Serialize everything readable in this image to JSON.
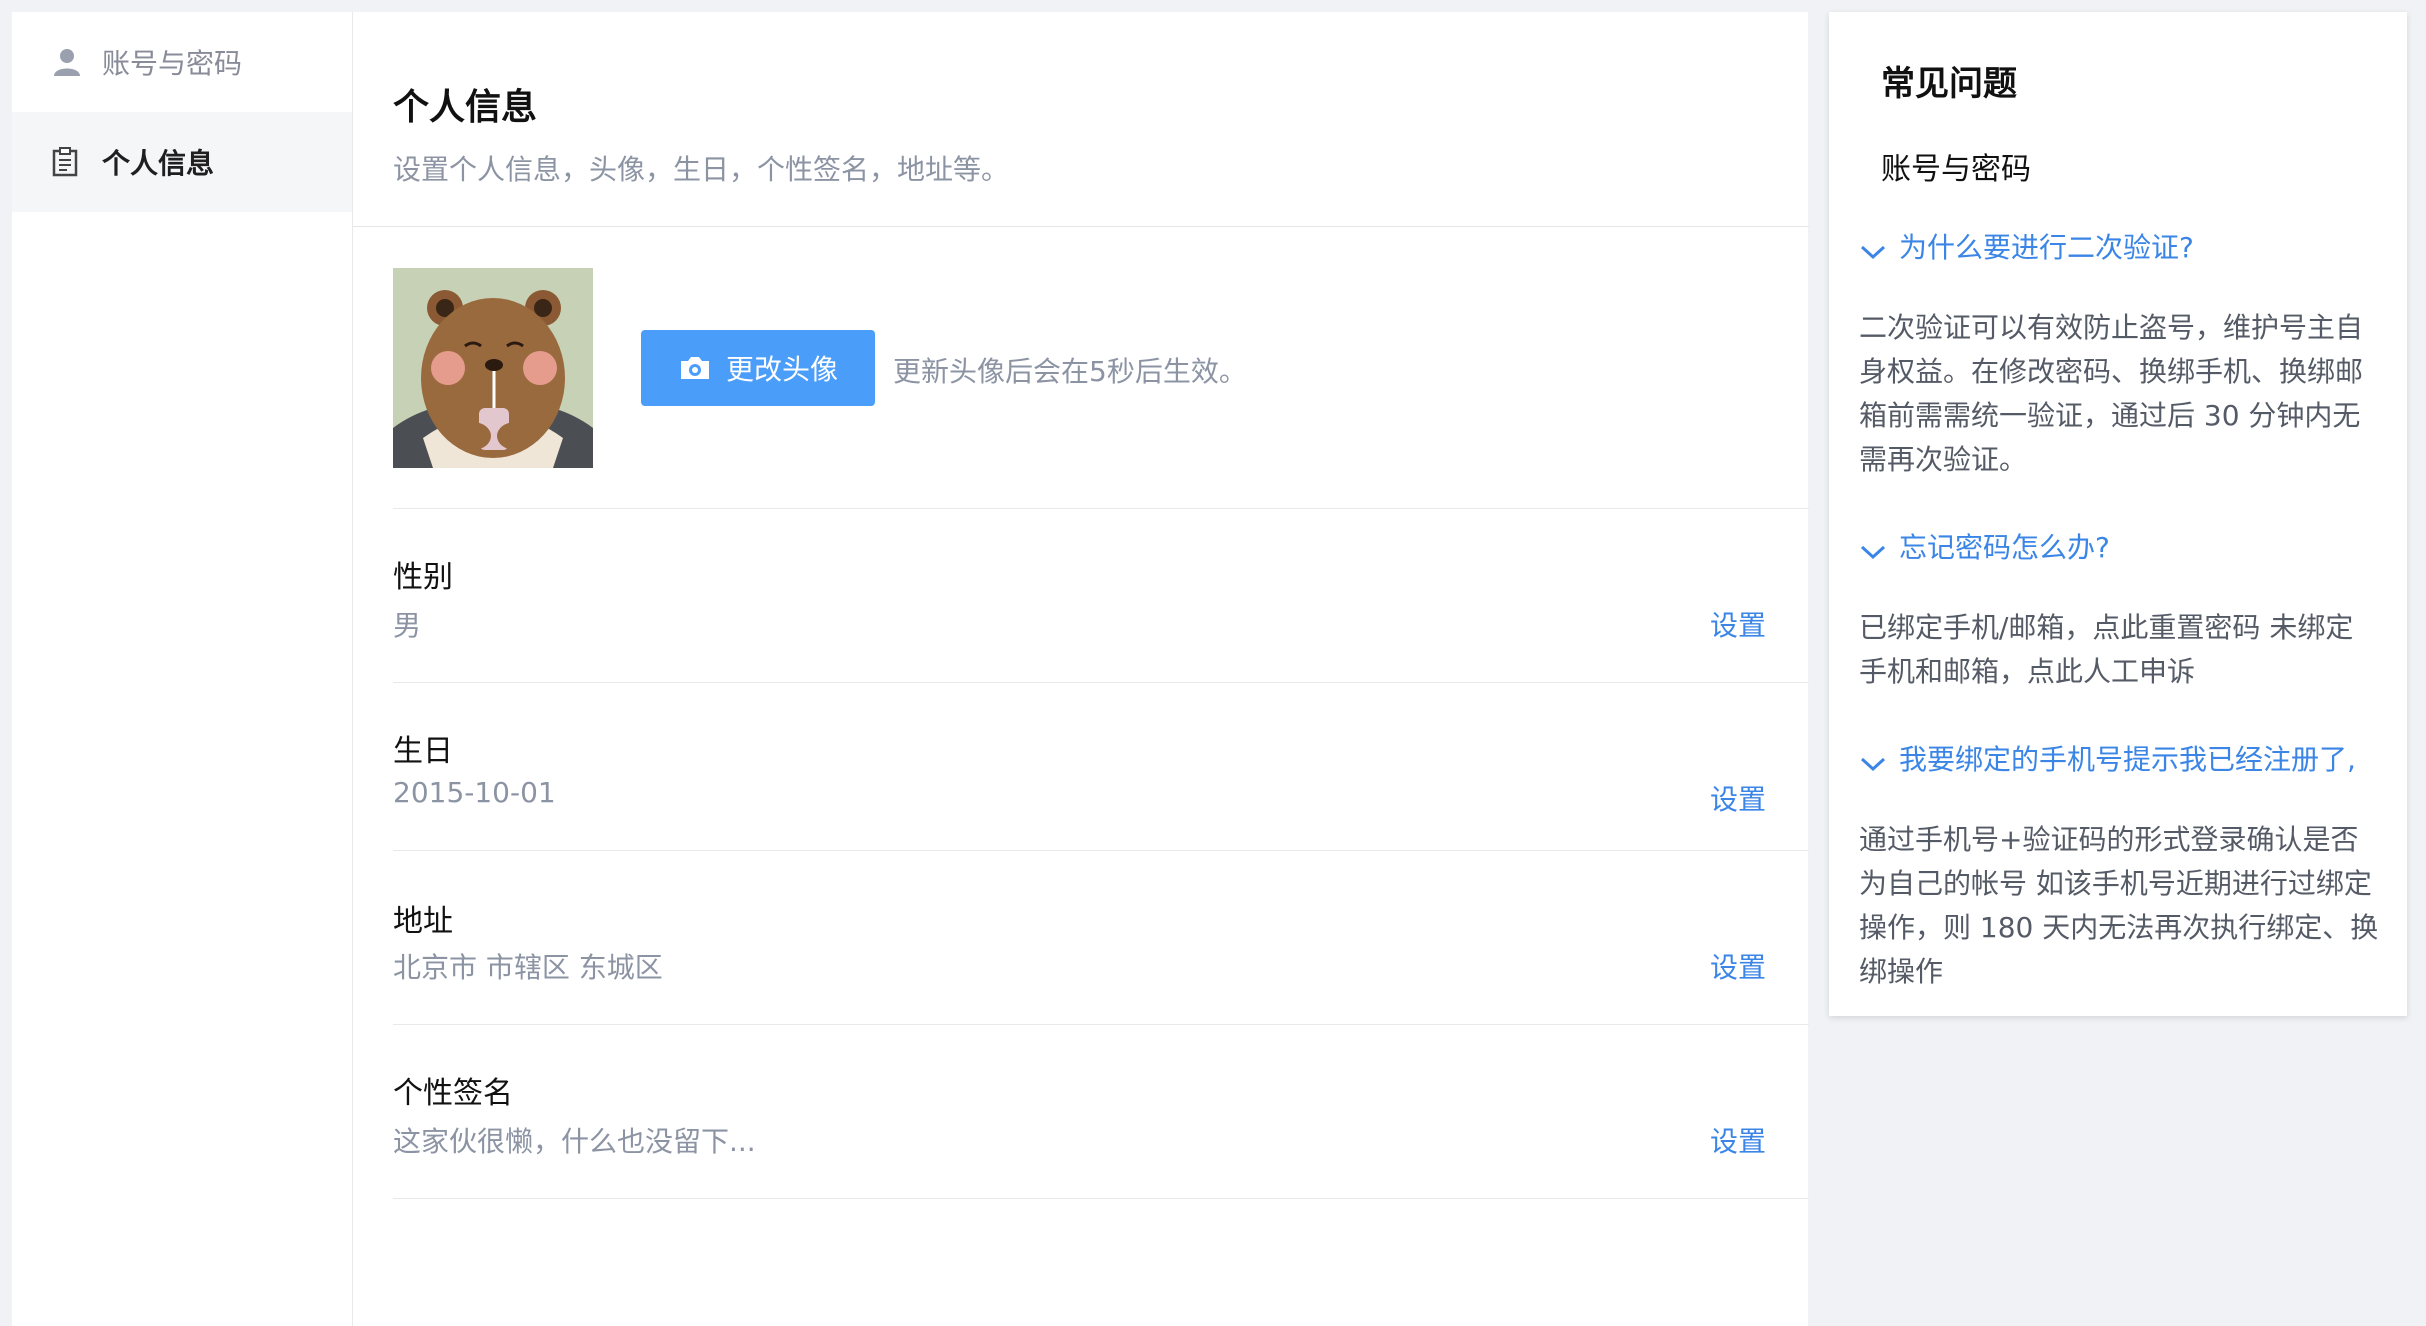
{
  "sidebar": {
    "items": [
      {
        "label": "账号与密码",
        "icon": "user-icon"
      },
      {
        "label": "个人信息",
        "icon": "clipboard-icon"
      }
    ]
  },
  "main": {
    "title": "个人信息",
    "description": "设置个人信息，头像，生日，个性签名，地址等。",
    "avatar": {
      "button_label": "更改头像",
      "button_icon": "camera-icon",
      "hint": "更新头像后会在5秒后生效。"
    },
    "fields": [
      {
        "label": "性别",
        "value": "男",
        "action": "设置"
      },
      {
        "label": "生日",
        "value": "2015-10-01",
        "action": "设置"
      },
      {
        "label": "地址",
        "value": "北京市 市辖区 东城区",
        "action": "设置"
      },
      {
        "label": "个性签名",
        "value": "这家伙很懒，什么也没留下...",
        "action": "设置"
      }
    ]
  },
  "faq": {
    "title": "常见问题",
    "section": "账号与密码",
    "items": [
      {
        "question": "为什么要进行二次验证?",
        "answer": "二次验证可以有效防止盗号，维护号主自身权益。在修改密码、换绑手机、换绑邮箱前需需统一验证，通过后 30 分钟内无需再次验证。"
      },
      {
        "question": "忘记密码怎么办?",
        "answer": "已绑定手机/邮箱，点此重置密码 未绑定手机和邮箱，点此人工申诉"
      },
      {
        "question": "我要绑定的手机号提示我已经注册了,",
        "answer": "通过手机号+验证码的形式登录确认是否为自己的帐号 如该手机号近期进行过绑定操作，则 180 天内无法再次执行绑定、换绑操作"
      }
    ]
  },
  "colors": {
    "accent": "#4a9df8",
    "link": "#3a85e6",
    "muted_text": "#8c94a4",
    "background": "#f0f2f5"
  }
}
